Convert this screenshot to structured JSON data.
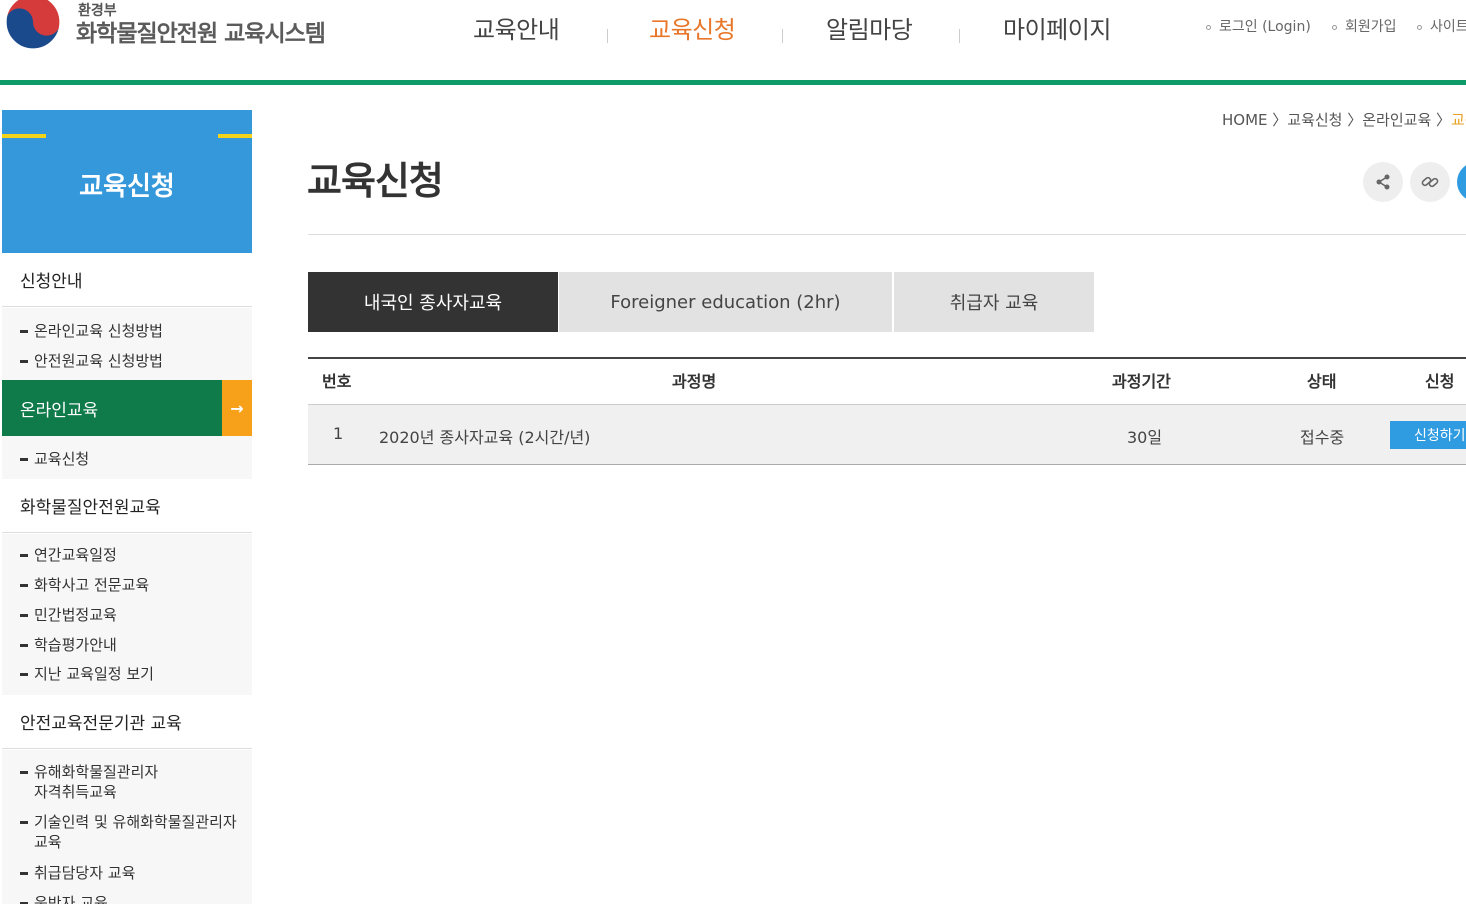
{
  "header": {
    "ministry": "환경부",
    "system_title": "화학물질안전원 교육시스템",
    "nav": [
      "교육안내",
      "교육신청",
      "알림마당",
      "마이페이지"
    ],
    "nav_active": "교육신청",
    "util": [
      "로그인 (Login)",
      "회원가입",
      "사이트"
    ],
    "accent_color": "#0f9a6a"
  },
  "sidebar": {
    "title": "교육신청",
    "cat1": "신청안내",
    "cat1_items": [
      "온라인교육 신청방법",
      "안전원교육 신청방법"
    ],
    "cat2": "온라인교육",
    "cat2_arrow": "→",
    "cat2_items": [
      "교육신청"
    ],
    "cat3": "화학물질안전원교육",
    "cat3_items": [
      "연간교육일정",
      "화학사고 전문교육",
      "민간법정교육",
      "학습평가안내",
      "지난 교육일정 보기"
    ],
    "cat4": "안전교육전문기관 교육",
    "cat4_items": [
      {
        "line1": "유해화학물질관리자",
        "line2": "자격취득교육"
      },
      {
        "line1": "기술인력 및 유해화학물질관리자",
        "line2": "교육"
      },
      {
        "line1": "취급담당자 교육",
        "line2": ""
      },
      {
        "line1": "운반자 교육",
        "line2": ""
      }
    ]
  },
  "breadcrumb": {
    "items": "HOME 〉교육신청 〉온라인교육 〉",
    "current": "교육"
  },
  "page": {
    "title": "교육신청",
    "share_icon": "share-icon",
    "link_icon": "link-icon"
  },
  "tabs": [
    "내국인 종사자교육",
    "Foreigner education (2hr)",
    "취급자 교육"
  ],
  "table": {
    "headers": [
      "번호",
      "과정명",
      "과정기간",
      "상태",
      "신청"
    ],
    "rows": [
      {
        "no": "1",
        "name": "2020년 종사자교육 (2시간/년)",
        "period": "30일",
        "status": "접수중",
        "action": "신청하기"
      }
    ]
  }
}
